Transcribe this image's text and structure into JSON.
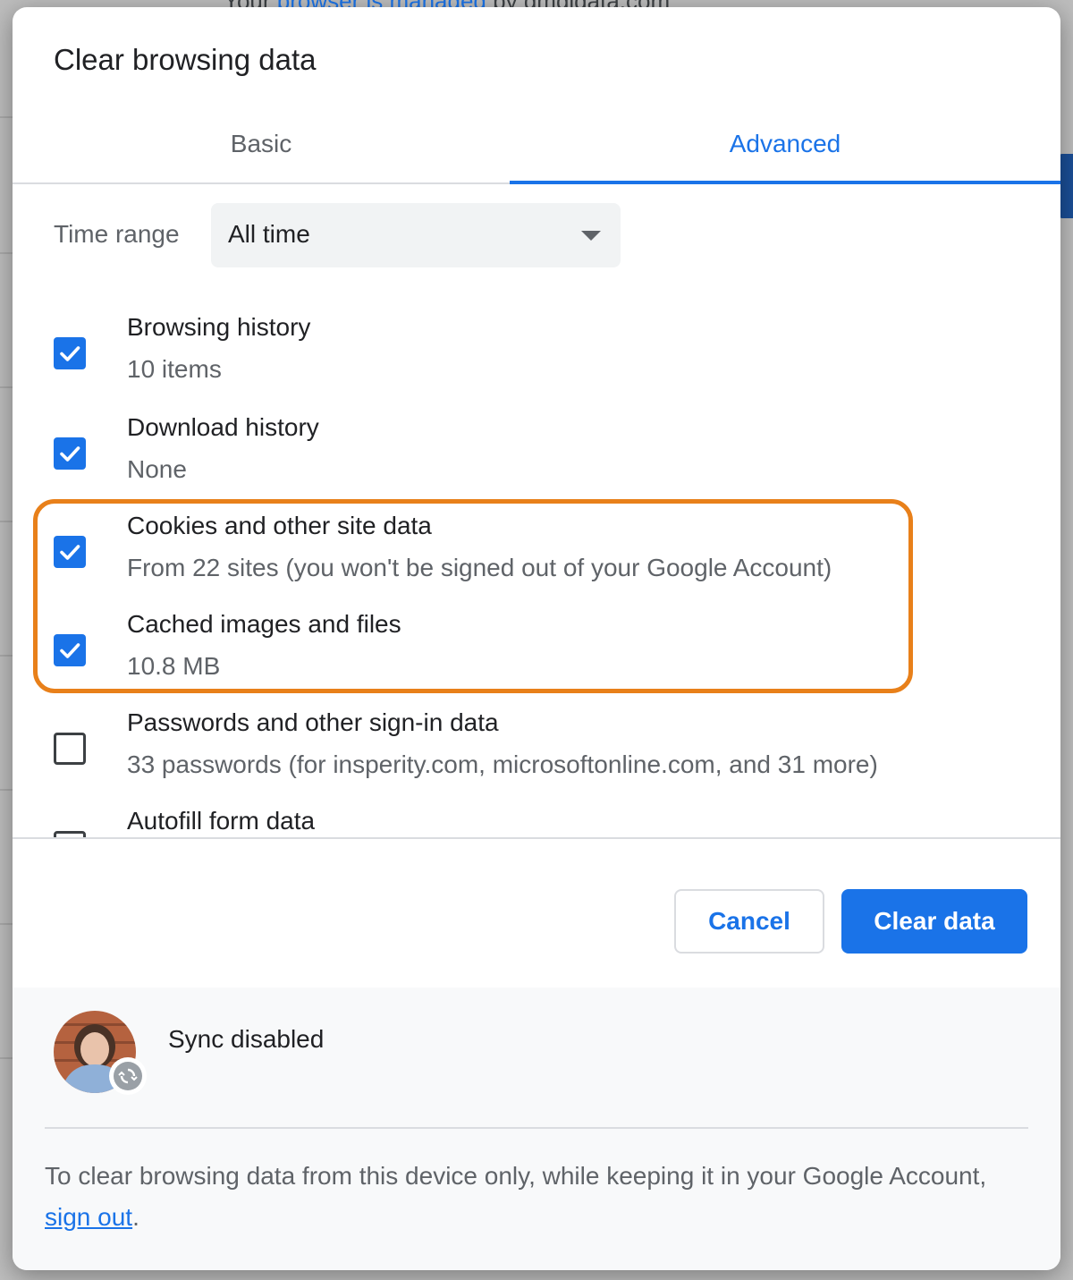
{
  "background": {
    "banner_text_prefix": "Your",
    "banner_link": "browser is managed",
    "banner_text_suffix": "by gmgidata.com"
  },
  "dialog": {
    "title": "Clear browsing data",
    "tabs": [
      {
        "label": "Basic",
        "selected": false
      },
      {
        "label": "Advanced",
        "selected": true
      }
    ],
    "time_range": {
      "label": "Time range",
      "value": "All time"
    },
    "items": [
      {
        "title": "Browsing history",
        "subtitle": "10 items",
        "checked": true
      },
      {
        "title": "Download history",
        "subtitle": "None",
        "checked": true
      },
      {
        "title": "Cookies and other site data",
        "subtitle": "From 22 sites (you won't be signed out of your Google Account)",
        "checked": true
      },
      {
        "title": "Cached images and files",
        "subtitle": "10.8 MB",
        "checked": true
      },
      {
        "title": "Passwords and other sign-in data",
        "subtitle": "33 passwords (for insperity.com, microsoftonline.com, and 31 more)",
        "checked": false
      },
      {
        "title": "Autofill form data",
        "subtitle": "",
        "checked": false
      }
    ],
    "buttons": {
      "cancel": "Cancel",
      "clear": "Clear data"
    },
    "footer": {
      "sync_status": "Sync disabled",
      "info_text": "To clear browsing data from this device only, while keeping it in your Google Account,",
      "link_text": "sign out",
      "info_end": "."
    }
  },
  "colors": {
    "accent": "#1a73e8",
    "highlight": "#e8801a",
    "text_primary": "#202124",
    "text_secondary": "#5f6368"
  },
  "icons": {
    "dropdown": "caret-down-icon",
    "checkbox": "checkmark-icon",
    "sync": "sync-icon"
  }
}
